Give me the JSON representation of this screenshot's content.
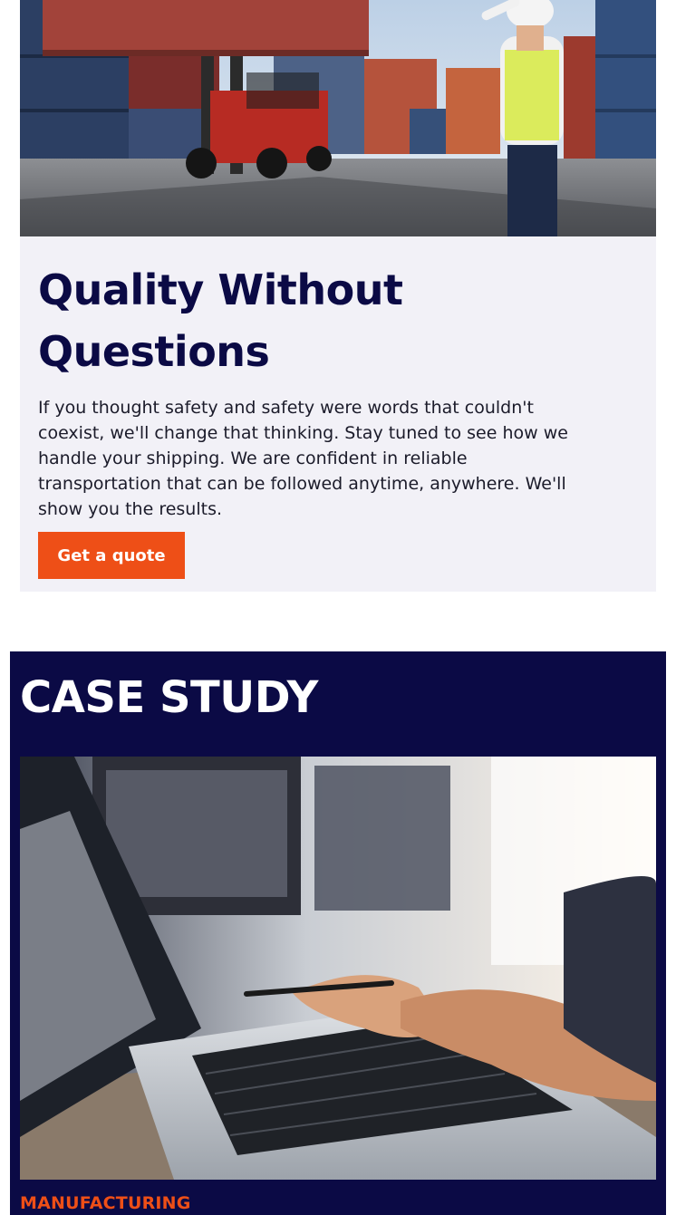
{
  "quality_section": {
    "title": "Quality Without Questions",
    "body": "If you thought safety and safety were words that couldn't coexist, we'll change that thinking. Stay tuned to see how we handle your shipping. We are confident in reliable transportation that can be followed anytime, anywhere. We'll show you the results.",
    "cta_label": "Get a quote"
  },
  "case_study": {
    "heading": "CASE STUDY",
    "category": "MANUFACTURING"
  },
  "colors": {
    "navy": "#0b0a45",
    "accent": "#ee4f17",
    "card_background": "#f2f1f7"
  }
}
